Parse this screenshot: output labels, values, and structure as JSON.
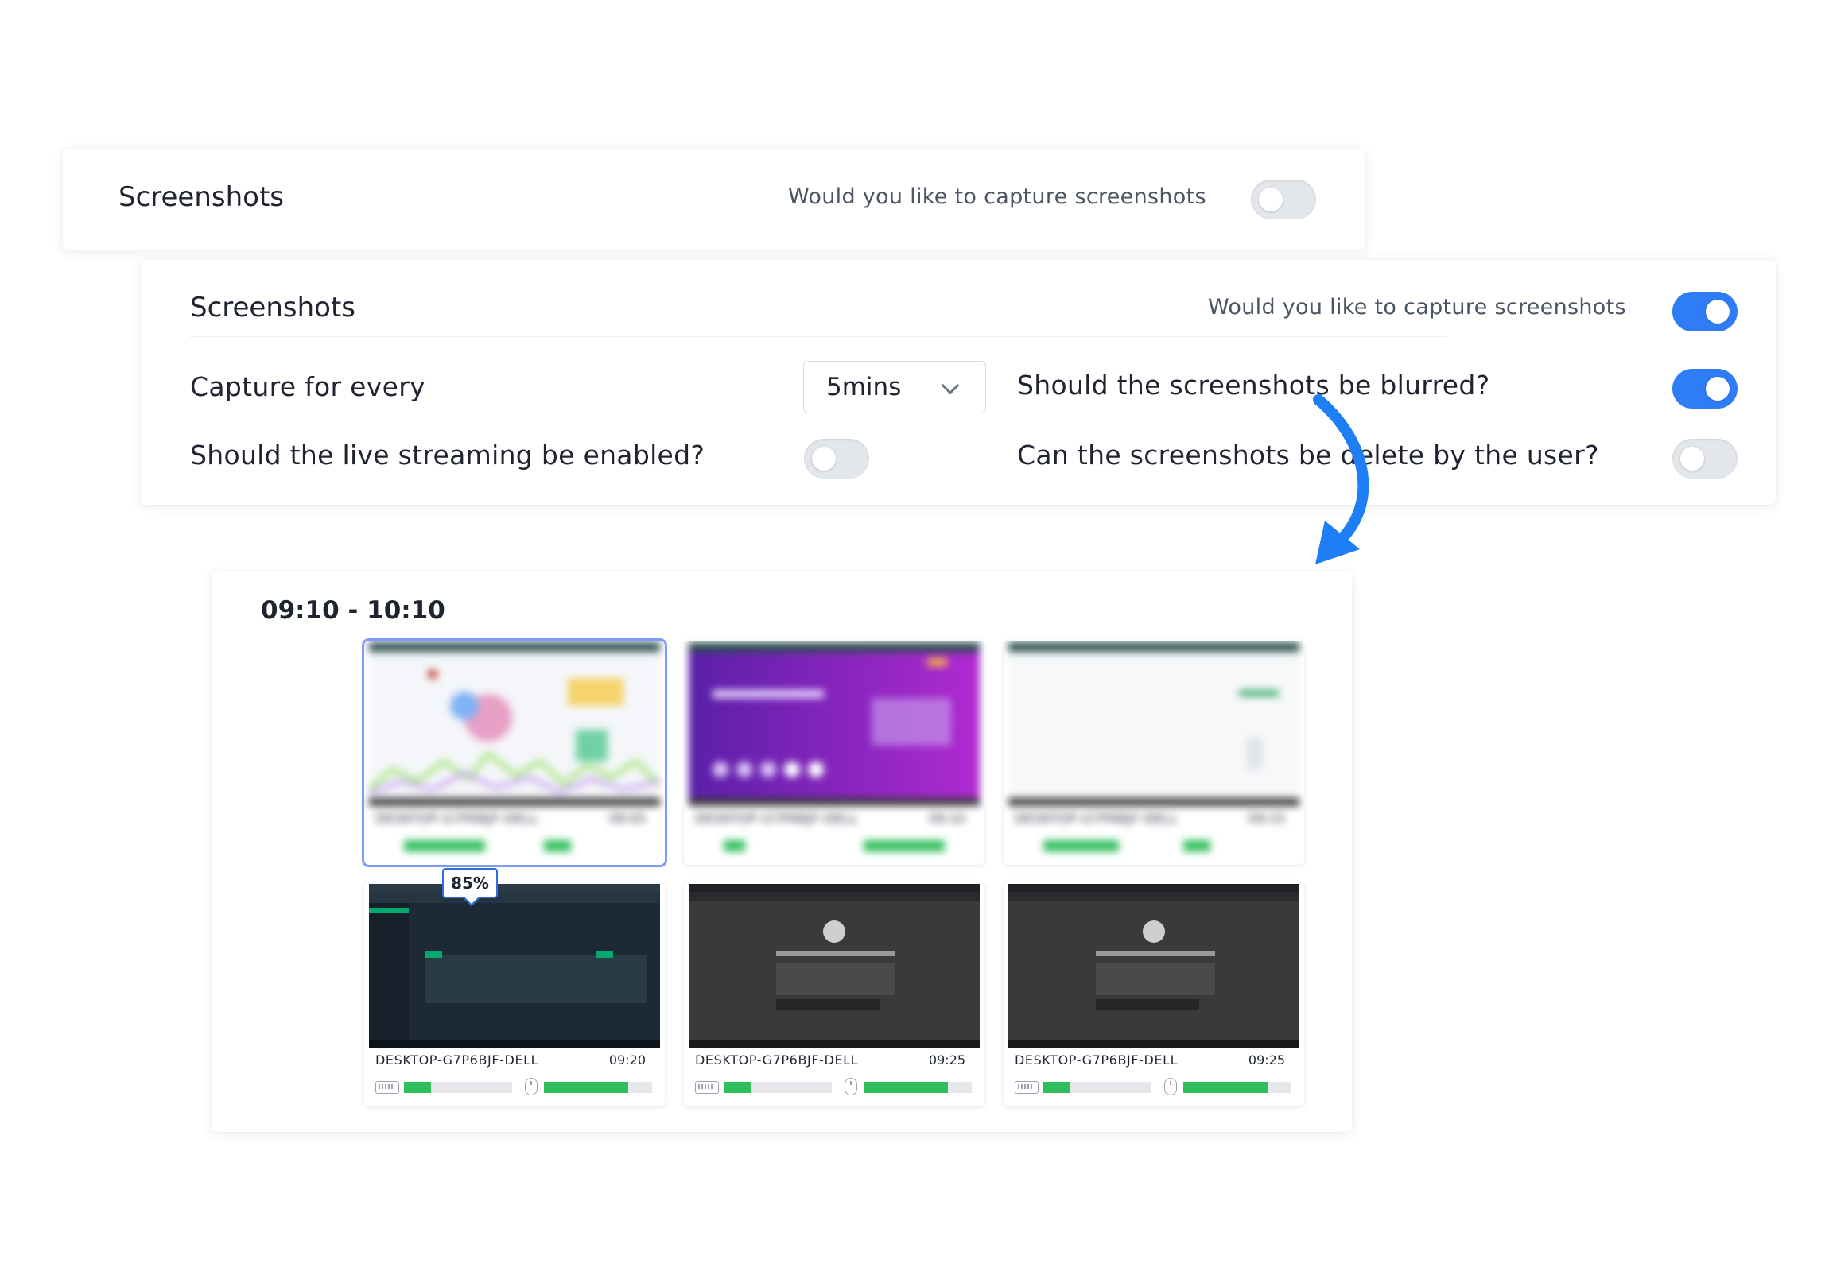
{
  "card_collapsed": {
    "title": "Screenshots",
    "question": "Would you like to capture screenshots",
    "enabled": false
  },
  "card_expanded": {
    "title": "Screenshots",
    "question": "Would you like to capture screenshots",
    "enabled": true,
    "capture_label": "Capture for every",
    "capture_value": "5mins",
    "blur_label": "Should the screenshots be blurred?",
    "blur_enabled": true,
    "stream_label": "Should the live streaming be enabled?",
    "stream_enabled": false,
    "delete_label": "Can the screenshots be delete by the user?",
    "delete_enabled": false
  },
  "gallery": {
    "range": "09:10 - 10:10",
    "tooltip": "85%",
    "thumbnails": [
      {
        "device": "DESKTOP-G7P6BJF-DELL",
        "time": "09:05",
        "keyboard": 0.75,
        "mouse": 0.25,
        "blurred": true
      },
      {
        "device": "DESKTOP-G7P6BJF-DELL",
        "time": "09:10",
        "keyboard": 0.2,
        "mouse": 0.75,
        "blurred": true
      },
      {
        "device": "DESKTOP-G7P6BJF-DELL",
        "time": "09:15",
        "keyboard": 0.7,
        "mouse": 0.25,
        "blurred": true
      },
      {
        "device": "DESKTOP-G7P6BJF-DELL",
        "time": "09:20",
        "keyboard": 0.25,
        "mouse": 0.78,
        "blurred": false
      },
      {
        "device": "DESKTOP-G7P6BJF-DELL",
        "time": "09:25",
        "keyboard": 0.25,
        "mouse": 0.78,
        "blurred": false
      },
      {
        "device": "DESKTOP-G7P6BJF-DELL",
        "time": "09:25",
        "keyboard": 0.25,
        "mouse": 0.78,
        "blurred": false
      }
    ]
  },
  "colors": {
    "accent": "#2f7df6",
    "activity": "#2fbe5a",
    "arrow": "#1e7ef5"
  }
}
